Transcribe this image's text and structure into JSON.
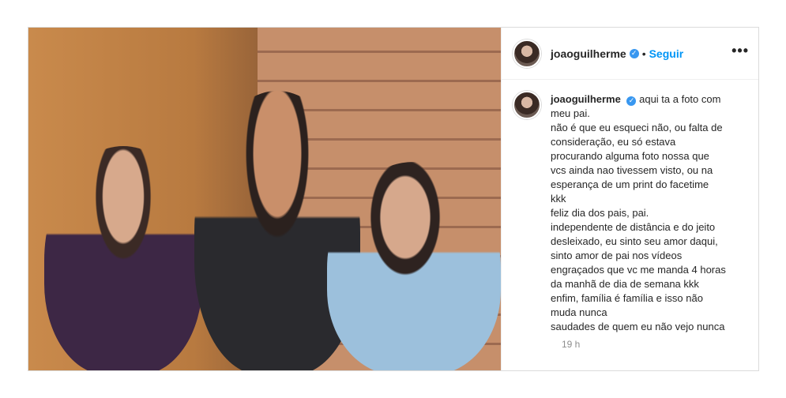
{
  "post": {
    "author": "joaoguilherme",
    "follow_label": "Seguir",
    "separator": "•",
    "more_label": "•••",
    "caption_first": "aqui ta a foto com",
    "caption_lines": [
      "meu pai.",
      "não é que eu esqueci não, ou falta de",
      "consideração, eu só estava",
      "procurando alguma foto nossa que",
      "vcs ainda nao tivessem visto, ou na",
      "esperança de um print do facetime",
      "kkk",
      "feliz dia dos pais, pai.",
      "independente de distância e do jeito",
      "desleixado, eu sinto seu amor daqui,",
      "sinto amor de pai nos vídeos",
      "engraçados que vc me manda 4 horas",
      "da manhã de dia de semana kkk",
      "enfim, família é família e isso não",
      "muda nunca",
      "saudades de quem eu não vejo nunca"
    ],
    "time_ago": "19 h"
  },
  "colors": {
    "accent": "#0095f6",
    "verified": "#3897f0",
    "border": "#dbdbdb"
  }
}
